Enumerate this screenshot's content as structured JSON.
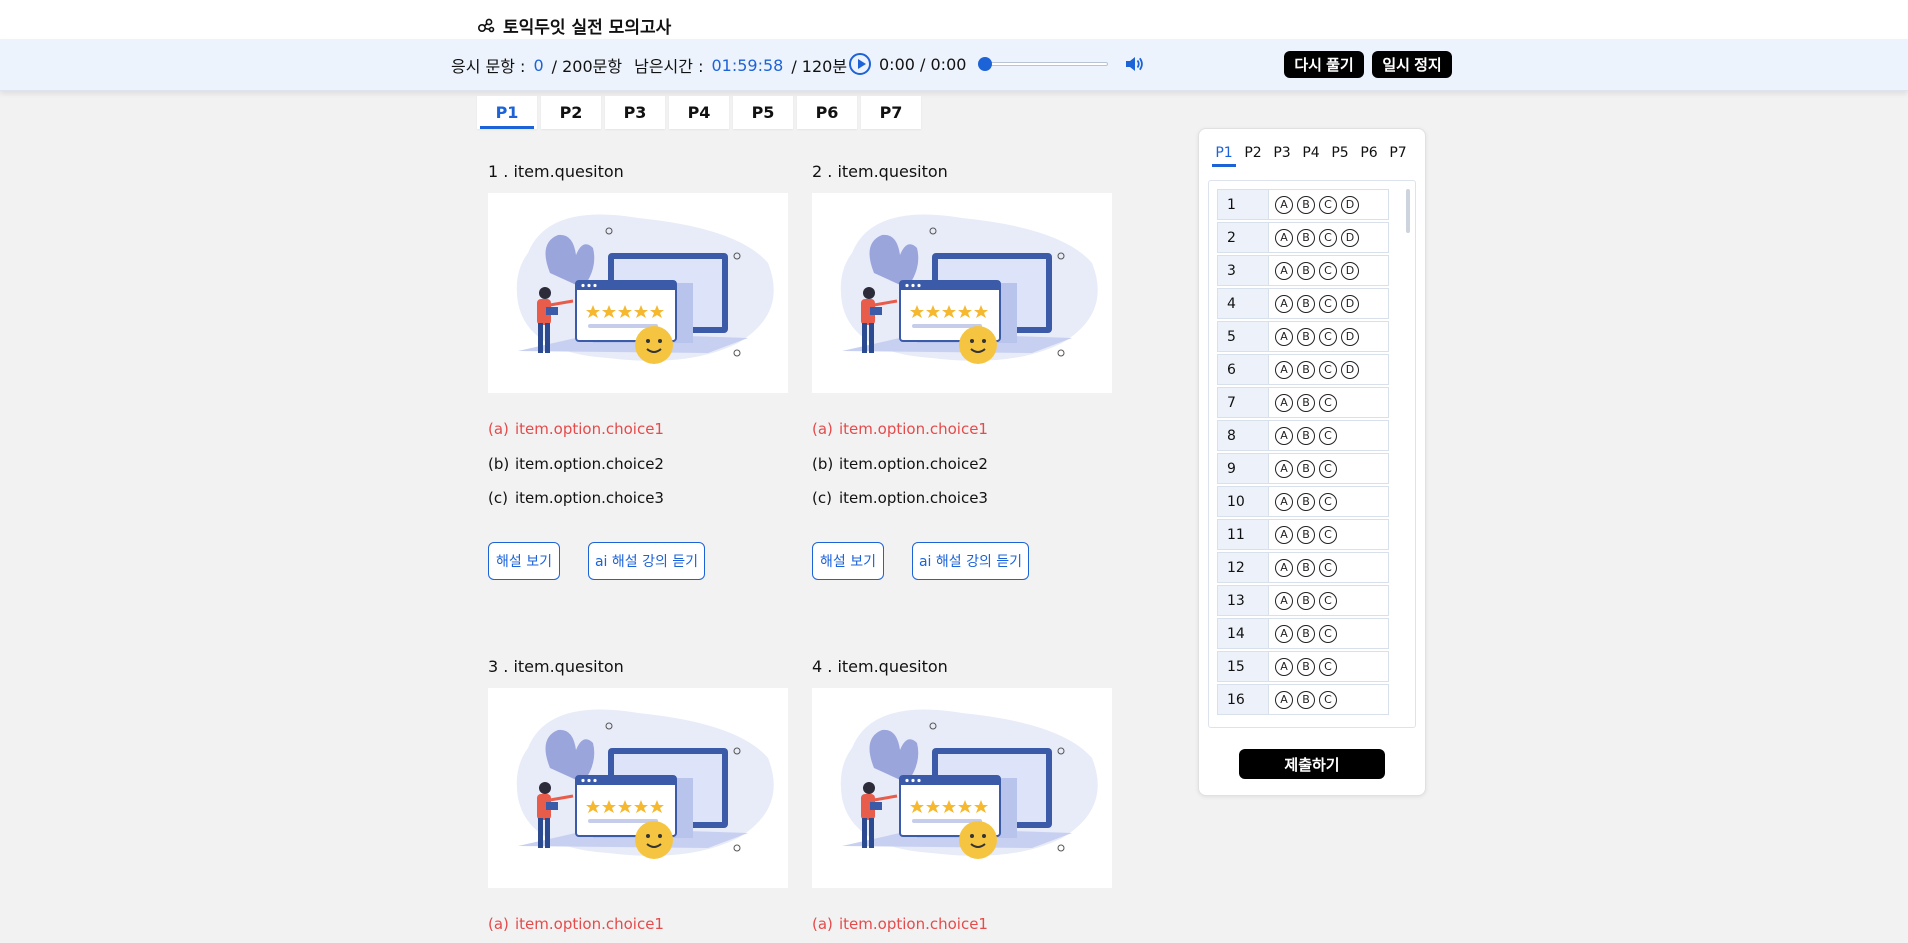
{
  "header": {
    "title": "토익두잇 실전 모의고사",
    "logo_icon": "link-nodes-icon"
  },
  "status": {
    "answered_label": "응시 문항 :",
    "answered_count": "0",
    "total_label": "/ 200문항",
    "remaining_label": "남은시간 :",
    "remaining_time": "01:59:58",
    "total_time": "/ 120분",
    "audio_time": "0:00 / 0:00",
    "audio_progress": 0,
    "accent_color": "#1d63d8"
  },
  "toolbar": {
    "retry_label": "다시 풀기",
    "pause_label": "일시 정지"
  },
  "part_tabs": [
    "P1",
    "P2",
    "P3",
    "P4",
    "P5",
    "P6",
    "P7"
  ],
  "active_part": "P1",
  "questions": [
    {
      "title": "1 .  item.quesiton",
      "options": [
        {
          "label": "(a)",
          "text": "item.option.choice1",
          "correct": true
        },
        {
          "label": "(b)",
          "text": "item.option.choice2",
          "correct": false
        },
        {
          "label": "(c)",
          "text": "item.option.choice3",
          "correct": false
        }
      ],
      "explain_label": "해설 보기",
      "ai_label": "ai 해설 강의 듣기"
    },
    {
      "title": "2 .  item.quesiton",
      "options": [
        {
          "label": "(a)",
          "text": "item.option.choice1",
          "correct": true
        },
        {
          "label": "(b)",
          "text": "item.option.choice2",
          "correct": false
        },
        {
          "label": "(c)",
          "text": "item.option.choice3",
          "correct": false
        }
      ],
      "explain_label": "해설 보기",
      "ai_label": "ai 해설 강의 듣기"
    },
    {
      "title": "3 .  item.quesiton",
      "options": [
        {
          "label": "(a)",
          "text": "item.option.choice1",
          "correct": true
        }
      ]
    },
    {
      "title": "4 .  item.quesiton",
      "options": [
        {
          "label": "(a)",
          "text": "item.option.choice1",
          "correct": true
        }
      ]
    }
  ],
  "answer_sheet": {
    "tabs": [
      "P1",
      "P2",
      "P3",
      "P4",
      "P5",
      "P6",
      "P7"
    ],
    "active_tab": "P1",
    "rows": [
      {
        "num": "1",
        "choices": [
          "A",
          "B",
          "C",
          "D"
        ]
      },
      {
        "num": "2",
        "choices": [
          "A",
          "B",
          "C",
          "D"
        ]
      },
      {
        "num": "3",
        "choices": [
          "A",
          "B",
          "C",
          "D"
        ]
      },
      {
        "num": "4",
        "choices": [
          "A",
          "B",
          "C",
          "D"
        ]
      },
      {
        "num": "5",
        "choices": [
          "A",
          "B",
          "C",
          "D"
        ]
      },
      {
        "num": "6",
        "choices": [
          "A",
          "B",
          "C",
          "D"
        ]
      },
      {
        "num": "7",
        "choices": [
          "A",
          "B",
          "C"
        ]
      },
      {
        "num": "8",
        "choices": [
          "A",
          "B",
          "C"
        ]
      },
      {
        "num": "9",
        "choices": [
          "A",
          "B",
          "C"
        ]
      },
      {
        "num": "10",
        "choices": [
          "A",
          "B",
          "C"
        ]
      },
      {
        "num": "11",
        "choices": [
          "A",
          "B",
          "C"
        ]
      },
      {
        "num": "12",
        "choices": [
          "A",
          "B",
          "C"
        ]
      },
      {
        "num": "13",
        "choices": [
          "A",
          "B",
          "C"
        ]
      },
      {
        "num": "14",
        "choices": [
          "A",
          "B",
          "C"
        ]
      },
      {
        "num": "15",
        "choices": [
          "A",
          "B",
          "C"
        ]
      },
      {
        "num": "16",
        "choices": [
          "A",
          "B",
          "C"
        ]
      }
    ],
    "submit_label": "제출하기"
  }
}
